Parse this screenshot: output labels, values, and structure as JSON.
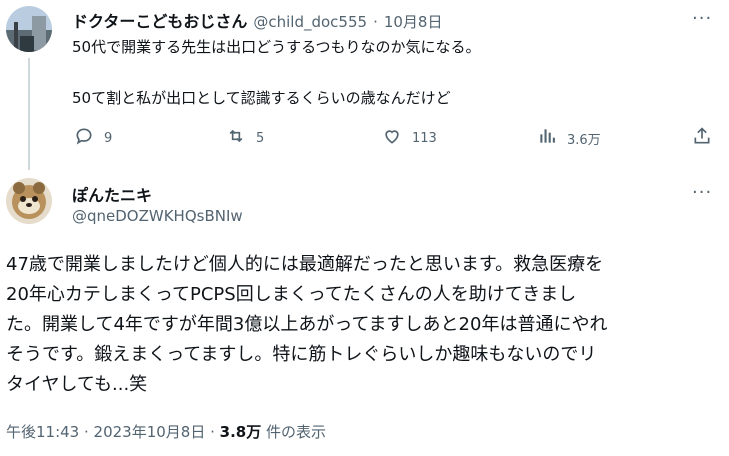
{
  "tweet1": {
    "author_name": "ドクターこどもおじさん",
    "handle": "@child_doc555",
    "separator": "·",
    "date": "10月8日",
    "line1": "50代で開業する先生は出口どうするつもりなのか気になる。",
    "line2": "50て割と私が出口として認識するくらいの歳なんだけど",
    "replies": "9",
    "retweets": "5",
    "likes": "113",
    "views": "3.6万"
  },
  "tweet2": {
    "author_name": "ぽんたニキ",
    "handle": "@qneDOZWKHQsBNIw",
    "lines": [
      "47歳で開業しましたけど個人的には最適解だったと思います。救急医療を",
      "20年心カテしまくってPCPS回しまくってたくさんの人を助けてきまし",
      "た。開業して4年ですが年間3億以上あがってますしあと20年は普通にやれ",
      "そうです。鍛えまくってますし。特に筋トレぐらいしか趣味もないのでリ",
      "タイヤしても...笑"
    ],
    "timestamp": "午後11:43 · 2023年10月8日 ·",
    "views_count": "3.8万",
    "views_label": "件の表示"
  },
  "colors": {
    "text": "#0f1419",
    "muted": "#536471",
    "thread_line": "#cfd9de"
  },
  "icons": [
    "reply-icon",
    "retweet-icon",
    "like-icon",
    "views-icon",
    "share-icon",
    "more-icon"
  ]
}
